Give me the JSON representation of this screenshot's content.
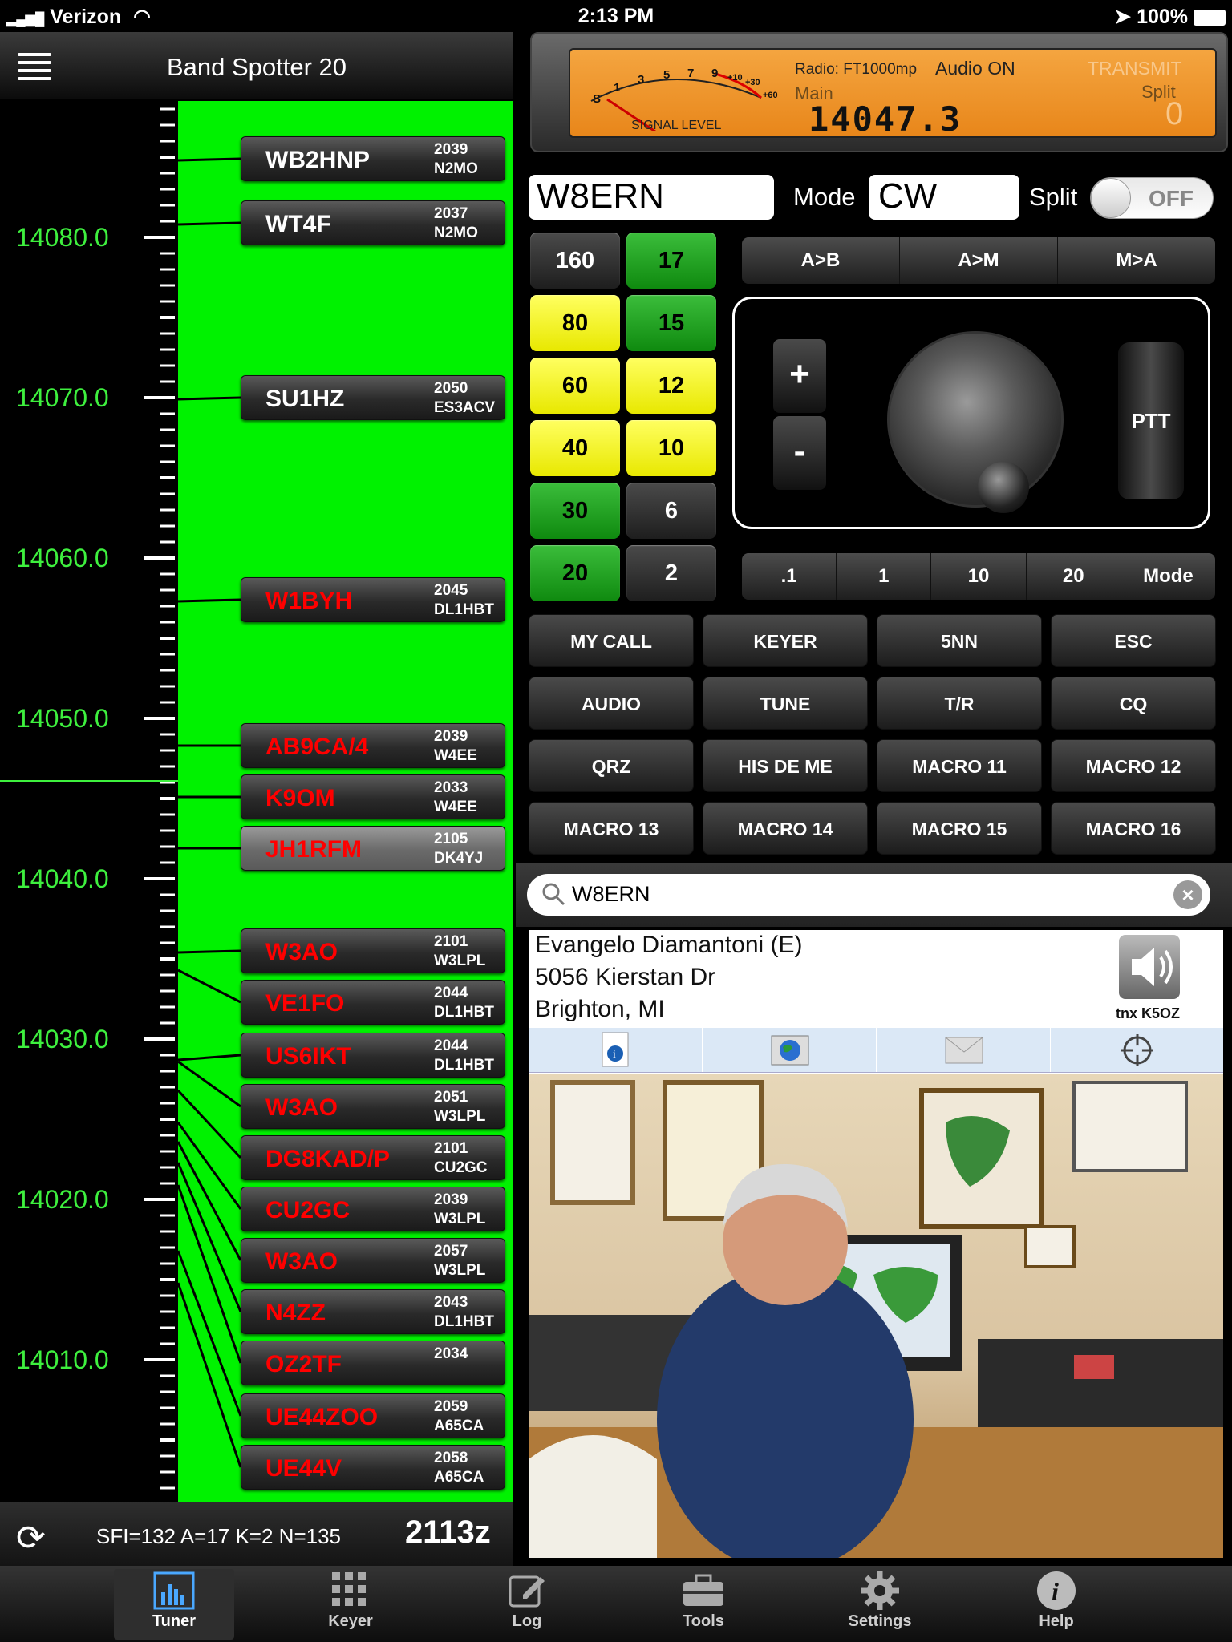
{
  "status_bar": {
    "carrier": "Verizon",
    "time": "2:13 PM",
    "battery": "100%"
  },
  "left_panel": {
    "title": "Band Spotter 20",
    "freq_labels": [
      "14080.0",
      "14070.0",
      "14060.0",
      "14050.0",
      "14040.0",
      "14030.0",
      "14020.0",
      "14010.0"
    ],
    "spots": [
      {
        "call": "WB2HNP",
        "time": "2039",
        "spotter": "N2MO",
        "red": false
      },
      {
        "call": "WT4F",
        "time": "2037",
        "spotter": "N2MO",
        "red": false
      },
      {
        "call": "SU1HZ",
        "time": "2050",
        "spotter": "ES3ACV",
        "red": false
      },
      {
        "call": "W1BYH",
        "time": "2045",
        "spotter": "DL1HBT",
        "red": true
      },
      {
        "call": "AB9CA/4",
        "time": "2039",
        "spotter": "W4EE",
        "red": true
      },
      {
        "call": "K9OM",
        "time": "2033",
        "spotter": "W4EE",
        "red": true
      },
      {
        "call": "JH1RFM",
        "time": "2105",
        "spotter": "DK4YJ",
        "red": true,
        "selected": true
      },
      {
        "call": "W3AO",
        "time": "2101",
        "spotter": "W3LPL",
        "red": true
      },
      {
        "call": "VE1FO",
        "time": "2044",
        "spotter": "DL1HBT",
        "red": true
      },
      {
        "call": "US6IKT",
        "time": "2044",
        "spotter": "DL1HBT",
        "red": true
      },
      {
        "call": "W3AO",
        "time": "2051",
        "spotter": "W3LPL",
        "red": true
      },
      {
        "call": "DG8KAD/P",
        "time": "2101",
        "spotter": "CU2GC",
        "red": true
      },
      {
        "call": "CU2GC",
        "time": "2039",
        "spotter": "W3LPL",
        "red": true
      },
      {
        "call": "W3AO",
        "time": "2057",
        "spotter": "W3LPL",
        "red": true
      },
      {
        "call": "N4ZZ",
        "time": "2043",
        "spotter": "DL1HBT",
        "red": true
      },
      {
        "call": "OZ2TF",
        "time": "2034",
        "spotter": "",
        "red": true
      },
      {
        "call": "UE44ZOO",
        "time": "2059",
        "spotter": "A65CA",
        "red": true
      },
      {
        "call": "UE44V",
        "time": "2058",
        "spotter": "A65CA",
        "red": true
      }
    ],
    "conditions": "SFI=132 A=17 K=2 N=135",
    "utc": "2113z"
  },
  "radio": {
    "radio_label": "Radio: FT1000mp",
    "audio": "Audio ON",
    "transmit": "TRANSMIT",
    "main_label": "Main",
    "split_label": "Split",
    "frequency": "14047.3",
    "split_value": "0",
    "signal_level": "SIGNAL LEVEL",
    "meter_scale": [
      "S",
      "1",
      "3",
      "5",
      "7",
      "9",
      "+10",
      "+30",
      "+60"
    ]
  },
  "controls": {
    "callsign": "W8ERN",
    "mode_label": "Mode",
    "mode_value": "CW",
    "split_label": "Split",
    "split_state": "OFF",
    "bands": [
      {
        "label": "160",
        "style": "dark"
      },
      {
        "label": "17",
        "style": "green"
      },
      {
        "label": "80",
        "style": "yellow"
      },
      {
        "label": "15",
        "style": "green"
      },
      {
        "label": "60",
        "style": "yellow"
      },
      {
        "label": "12",
        "style": "yellow"
      },
      {
        "label": "40",
        "style": "yellow"
      },
      {
        "label": "10",
        "style": "yellow"
      },
      {
        "label": "30",
        "style": "green"
      },
      {
        "label": "6",
        "style": "dark"
      },
      {
        "label": "20",
        "style": "green"
      },
      {
        "label": "2",
        "style": "dark"
      }
    ],
    "vfo_buttons": [
      "A>B",
      "A>M",
      "M>A"
    ],
    "plus": "+",
    "minus": "-",
    "ptt": "PTT",
    "steps": [
      ".1",
      "1",
      "10",
      "20",
      "Mode"
    ],
    "macros": [
      "MY CALL",
      "KEYER",
      "5NN",
      "ESC",
      "AUDIO",
      "TUNE",
      "T/R",
      "CQ",
      "QRZ",
      "HIS DE ME",
      "MACRO 11",
      "MACRO 12",
      "MACRO 13",
      "MACRO 14",
      "MACRO 15",
      "MACRO 16"
    ]
  },
  "lookup": {
    "search_value": "W8ERN",
    "name": "Evangelo Diamantoni (E)",
    "street": "5056 Kierstan Dr",
    "city": "Brighton, MI",
    "credit": "tnx K5OZ",
    "tab_icons": [
      "info-icon",
      "globe-icon",
      "mail-icon",
      "target-icon"
    ]
  },
  "tabbar": {
    "tabs": [
      "Tuner",
      "Keyer",
      "Log",
      "Tools",
      "Settings",
      "Help"
    ],
    "active": "Tuner"
  }
}
